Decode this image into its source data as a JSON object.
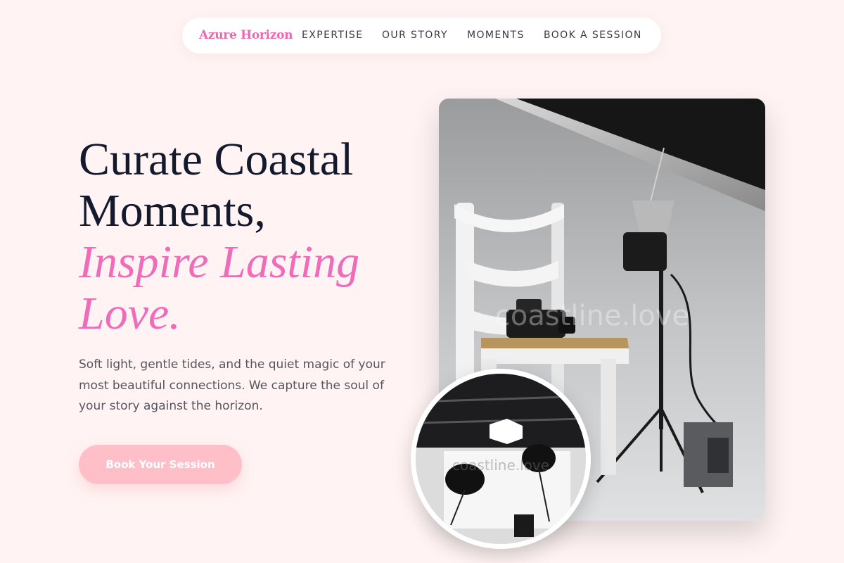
{
  "nav": {
    "brand": "Azure Horizon",
    "links": [
      "EXPERTISE",
      "OUR STORY",
      "MOMENTS",
      "BOOK A SESSION"
    ]
  },
  "hero": {
    "headline_line1": "Curate Coastal",
    "headline_line2": "Moments,",
    "headline_accent": "Inspire Lasting Love.",
    "subtext": "Soft light, gentle tides, and the quiet magic of your most beautiful connections. We capture the soul of your story against the horizon.",
    "cta_label": "Book Your Session"
  },
  "images": {
    "main_watermark": "coastline.love",
    "circle_watermark": "coastline.love",
    "main_alt": "photo studio with white chair, camera and studio light",
    "circle_alt": "photo studio with softbox lights and white backdrop"
  },
  "colors": {
    "background": "#fff4f3",
    "brand": "#ec66b4",
    "accent": "#f06cba",
    "heading": "#141a2e",
    "cta_background": "#ffbfc8"
  }
}
